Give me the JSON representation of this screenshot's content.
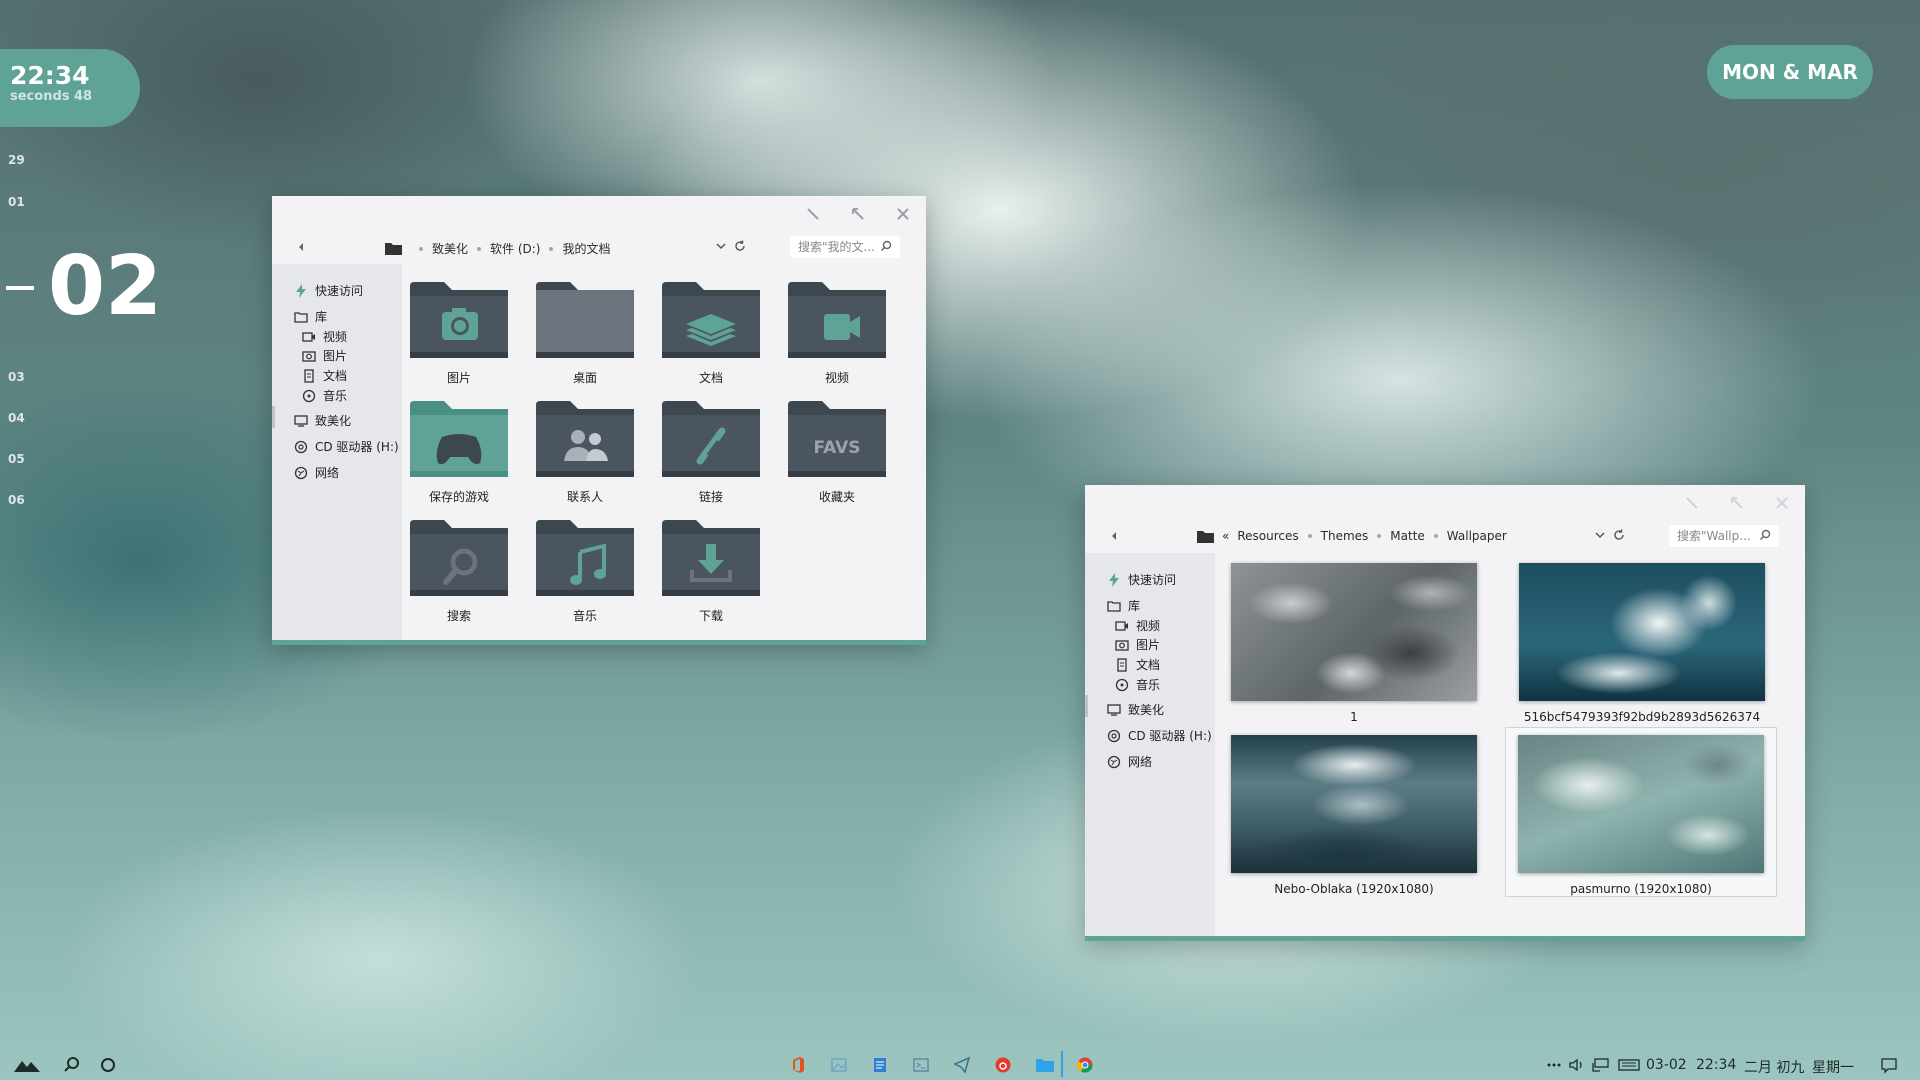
{
  "clock": {
    "time": "22:34",
    "seconds": "seconds 48"
  },
  "dates": {
    "before": [
      "29",
      "01"
    ],
    "current": "02",
    "after": [
      "03",
      "04",
      "05",
      "06"
    ]
  },
  "month_badge": "MON & MAR",
  "window1": {
    "path": [
      "致美化",
      "软件 (D:)",
      "我的文档"
    ],
    "search_placeholder": "搜索\"我的文...",
    "sidebar": {
      "quick_access": "快速访问",
      "library": "库",
      "video": "视频",
      "pictures": "图片",
      "docs": "文档",
      "music": "音乐",
      "pc": "致美化",
      "cd": "CD 驱动器 (H:)",
      "network": "网络"
    },
    "folders": [
      {
        "label": "图片",
        "icon": "camera-icon"
      },
      {
        "label": "桌面",
        "icon": "desktop-icon"
      },
      {
        "label": "文档",
        "icon": "layers-icon"
      },
      {
        "label": "视频",
        "icon": "video-icon"
      },
      {
        "label": "保存的游戏",
        "icon": "gamepad-icon"
      },
      {
        "label": "联系人",
        "icon": "contacts-icon"
      },
      {
        "label": "链接",
        "icon": "link-icon"
      },
      {
        "label": "收藏夹",
        "icon": "favs-icon",
        "badge": "FAVS"
      },
      {
        "label": "搜索",
        "icon": "search-icon"
      },
      {
        "label": "音乐",
        "icon": "music-icon"
      },
      {
        "label": "下载",
        "icon": "download-icon"
      }
    ]
  },
  "window2": {
    "path_prefix": "«",
    "path": [
      "Resources",
      "Themes",
      "Matte",
      "Wallpaper"
    ],
    "search_placeholder": "搜索\"Wallp...",
    "sidebar": {
      "quick_access": "快速访问",
      "library": "库",
      "video": "视频",
      "pictures": "图片",
      "docs": "文档",
      "music": "音乐",
      "pc": "致美化",
      "cd": "CD 驱动器 (H:)",
      "network": "网络"
    },
    "files": [
      {
        "label": "1"
      },
      {
        "label": "516bcf5479393f92bd9b2893d5626374"
      },
      {
        "label": "Nebo-Oblaka (1920x1080)"
      },
      {
        "label": "pasmurno (1920x1080)"
      }
    ]
  },
  "taskbar": {
    "tray": {
      "date": "03-02",
      "time": "22:34",
      "lunar": "二月 初九",
      "weekday": "星期一"
    }
  },
  "colors": {
    "accent": "#5fa397",
    "folder": "#3d4750",
    "folder_green": "#5fa397"
  }
}
